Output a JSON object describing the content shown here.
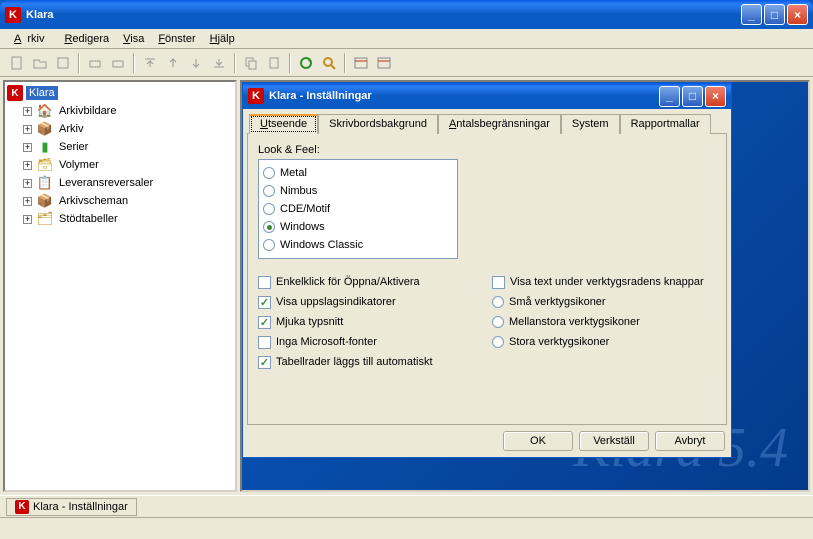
{
  "mainWindow": {
    "title": "Klara",
    "iconLetter": "K"
  },
  "menu": {
    "arkiv": "Arkiv",
    "redigera": "Redigera",
    "visa": "Visa",
    "fonster": "Fönster",
    "hjalp": "Hjälp"
  },
  "tree": {
    "root": "Klara",
    "items": [
      {
        "label": "Arkivbildare",
        "iconColor": "#2a8f2a"
      },
      {
        "label": "Arkiv",
        "iconColor": "#c03020"
      },
      {
        "label": "Serier",
        "iconColor": "#30a030"
      },
      {
        "label": "Volymer",
        "iconColor": "#d0a020"
      },
      {
        "label": "Leveransreversaler",
        "iconColor": "#888"
      },
      {
        "label": "Arkivscheman",
        "iconColor": "#6060c0"
      },
      {
        "label": "Stödtabeller",
        "iconColor": "#c09020"
      }
    ]
  },
  "watermark": "Klara 5.4",
  "dialog": {
    "title": "Klara - Inställningar",
    "tabs": {
      "utseende": "Utseende",
      "skrivbord": "Skrivbordsbakgrund",
      "antal": "Antalsbegränsningar",
      "system": "System",
      "rapport": "Rapportmallar"
    },
    "lookFeelLabel": "Look & Feel:",
    "lookFeel": [
      {
        "label": "Metal",
        "checked": false
      },
      {
        "label": "Nimbus",
        "checked": false
      },
      {
        "label": "CDE/Motif",
        "checked": false
      },
      {
        "label": "Windows",
        "checked": true
      },
      {
        "label": "Windows Classic",
        "checked": false
      }
    ],
    "leftChecks": [
      {
        "label": "Enkelklick för Öppna/Aktivera",
        "checked": false
      },
      {
        "label": "Visa uppslagsindikatorer",
        "checked": true
      },
      {
        "label": "Mjuka typsnitt",
        "checked": true
      },
      {
        "label": "Inga Microsoft-fonter",
        "checked": false
      },
      {
        "label": "Tabellrader läggs till automatiskt",
        "checked": true
      }
    ],
    "rightChecks": [
      {
        "label": "Visa text under verktygsradens knappar",
        "checked": false
      }
    ],
    "iconSize": [
      {
        "label": "Små verktygsikoner",
        "checked": false
      },
      {
        "label": "Mellanstora verktygsikoner",
        "checked": false
      },
      {
        "label": "Stora verktygsikoner",
        "checked": false
      }
    ],
    "buttons": {
      "ok": "OK",
      "verkstall": "Verkställ",
      "avbryt": "Avbryt"
    }
  },
  "taskbar": {
    "item1": "Klara - Inställningar"
  }
}
